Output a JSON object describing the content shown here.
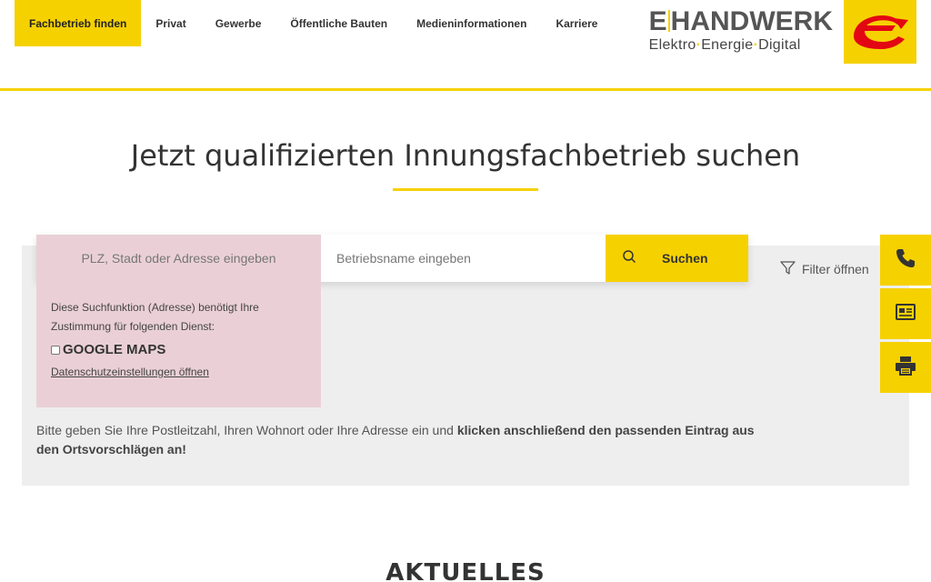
{
  "nav": {
    "items": [
      {
        "label": "Fachbetrieb finden",
        "active": true
      },
      {
        "label": "Privat"
      },
      {
        "label": "Gewerbe"
      },
      {
        "label": "Öffentliche Bauten"
      },
      {
        "label": "Medieninformationen"
      },
      {
        "label": "Karriere"
      }
    ]
  },
  "logo": {
    "left": "E",
    "right": "HANDWERK",
    "sub1": "Elektro",
    "sub2": "Energie",
    "sub3": "Digital",
    "dot": "·"
  },
  "headline": "Jetzt qualifizierten Innungsfachbetrieb suchen",
  "search": {
    "plz_placeholder": "PLZ, Stadt oder Adresse eingeben",
    "name_placeholder": "Betriebsname eingeben",
    "button_label": "Suchen"
  },
  "consent": {
    "text": "Diese Suchfunktion (Adresse) benötigt Ihre Zustimmung für folgenden Dienst:",
    "service": "GOOGLE MAPS",
    "link": "Datenschutzeinstellungen öffnen"
  },
  "filter_label": "Filter öffnen",
  "hint": {
    "normal": "Bitte geben Sie Ihre Postleitzahl, Ihren Wohnort oder Ihre Adresse ein und ",
    "bold": "klicken anschließend den passenden Eintrag aus den Ortsvorschlägen an!"
  },
  "side_actions": [
    "phone-icon",
    "news-icon",
    "print-icon"
  ],
  "section_title": "AKTUELLES",
  "colors": {
    "accent": "#f6d100",
    "consent_bg": "#ead0d6",
    "panel_bg": "#eeeeee",
    "logo_red": "#e30613"
  }
}
